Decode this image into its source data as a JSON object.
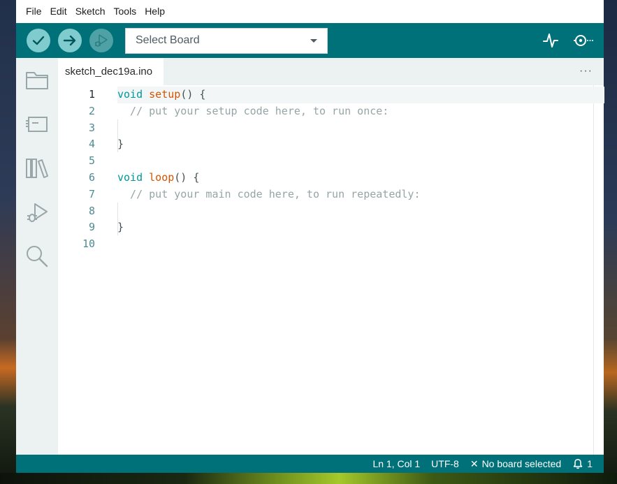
{
  "menubar": {
    "items": [
      "File",
      "Edit",
      "Sketch",
      "Tools",
      "Help"
    ]
  },
  "toolbar": {
    "verify_icon": "check-icon",
    "upload_icon": "arrow-right-icon",
    "debug_icon": "debug-play-icon",
    "board_select_value": "Select Board",
    "serial_plotter_icon": "plotter-icon",
    "serial_monitor_icon": "serial-monitor-icon"
  },
  "sidebar": {
    "items": [
      {
        "icon": "folder-icon"
      },
      {
        "icon": "board-manager-icon"
      },
      {
        "icon": "library-icon"
      },
      {
        "icon": "debug-icon"
      },
      {
        "icon": "search-icon"
      }
    ]
  },
  "tabs": {
    "active_tab": "sketch_dec19a.ino",
    "more_label": "···"
  },
  "editor": {
    "line_numbers": [
      "1",
      "2",
      "3",
      "4",
      "5",
      "6",
      "7",
      "8",
      "9",
      "10"
    ],
    "lines": [
      [
        {
          "t": "void",
          "c": "kw"
        },
        {
          "t": " ",
          "c": "pn"
        },
        {
          "t": "setup",
          "c": "fn"
        },
        {
          "t": "() {",
          "c": "pn"
        }
      ],
      [
        {
          "t": "  // put your setup code here, to run once:",
          "c": "cm"
        }
      ],
      [],
      [
        {
          "t": "}",
          "c": "pn"
        }
      ],
      [],
      [
        {
          "t": "void",
          "c": "kw"
        },
        {
          "t": " ",
          "c": "pn"
        },
        {
          "t": "loop",
          "c": "fn"
        },
        {
          "t": "() {",
          "c": "pn"
        }
      ],
      [
        {
          "t": "  // put your main code here, to run repeatedly:",
          "c": "cm"
        }
      ],
      [],
      [
        {
          "t": "}",
          "c": "pn"
        }
      ],
      []
    ]
  },
  "statusbar": {
    "position": "Ln 1, Col 1",
    "encoding": "UTF-8",
    "board_status": "No board selected",
    "notifications_count": "1"
  },
  "colors": {
    "accent": "#007178",
    "button_light": "#7fcbcd",
    "keyword": "#00979c",
    "function": "#d35400",
    "comment": "#95a5a6"
  }
}
